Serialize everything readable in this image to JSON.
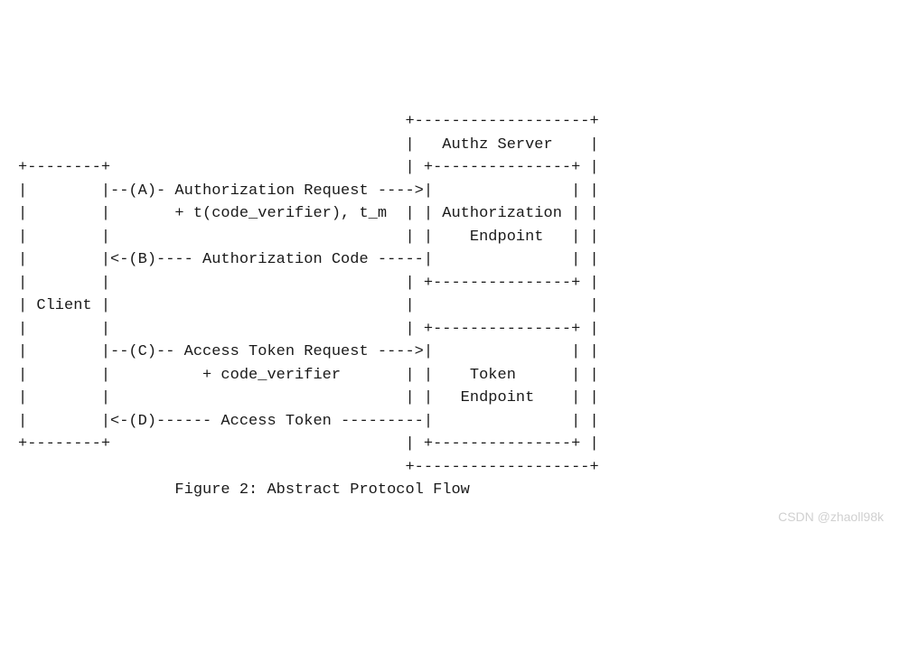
{
  "diagram": {
    "lines": [
      "                                          +-------------------+",
      "                                          |   Authz Server    |",
      "+--------+                                | +---------------+ |",
      "|        |--(A)- Authorization Request ---->|               | |",
      "|        |       + t(code_verifier), t_m  | | Authorization | |",
      "|        |                                | |    Endpoint   | |",
      "|        |<-(B)---- Authorization Code -----|               | |",
      "|        |                                | +---------------+ |",
      "| Client |                                |                   |",
      "|        |                                | +---------------+ |",
      "|        |--(C)-- Access Token Request ---->|               | |",
      "|        |          + code_verifier       | |    Token      | |",
      "|        |                                | |   Endpoint    | |",
      "|        |<-(D)------ Access Token ---------|               | |",
      "+--------+                                | +---------------+ |",
      "                                          +-------------------+",
      "",
      "                 Figure 2: Abstract Protocol Flow"
    ]
  },
  "watermark": "CSDN @zhaoll98k",
  "entities": {
    "left_box": "Client",
    "right_box_title": "Authz Server",
    "right_box_section1": "Authorization Endpoint",
    "right_box_section2": "Token Endpoint"
  },
  "flows": [
    {
      "label": "A",
      "direction": "right",
      "text": "Authorization Request",
      "extra": "+ t(code_verifier), t_m"
    },
    {
      "label": "B",
      "direction": "left",
      "text": "Authorization Code"
    },
    {
      "label": "C",
      "direction": "right",
      "text": "Access Token Request",
      "extra": "+ code_verifier"
    },
    {
      "label": "D",
      "direction": "left",
      "text": "Access Token"
    }
  ],
  "caption": "Figure 2: Abstract Protocol Flow"
}
